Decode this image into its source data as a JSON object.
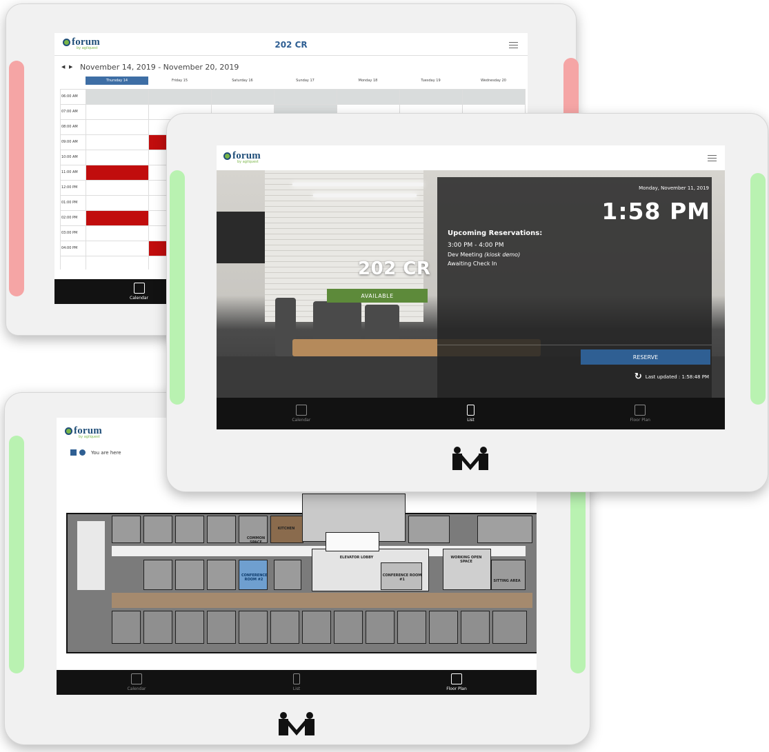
{
  "brand": {
    "logo_word": "forum",
    "logo_sub": "by agilquest",
    "device_logo": "M-icon"
  },
  "colors": {
    "led_red": "#f5a5a5",
    "led_green": "#b9f2b1",
    "available_green": "#5d8a3a",
    "reserve_blue": "#2f5f93",
    "event_red": "#c10d0d",
    "today_blue": "#3e6ea5"
  },
  "calendar_panel": {
    "room_title": "202 CR",
    "date_range": "November 14, 2019 - November 20, 2019",
    "days": [
      "Thursday 14",
      "Friday 15",
      "Saturday 16",
      "Sunday 17",
      "Monday 18",
      "Tuesday 19",
      "Wednesday 20"
    ],
    "times": [
      "06:00 AM",
      "07:00 AM",
      "08:00 AM",
      "09:00 AM",
      "10:00 AM",
      "11:00 AM",
      "12:00 PM",
      "01:00 PM",
      "02:00 PM",
      "03:00 PM",
      "04:00 PM"
    ],
    "nav": [
      {
        "label": "Calendar",
        "icon": "calendar-icon"
      }
    ]
  },
  "room_panel": {
    "room_name": "202 CR",
    "status_button": "AVAILABLE",
    "date": "Monday, November 11, 2019",
    "time": "1:58 PM",
    "upcoming_heading": "Upcoming Reservations:",
    "reservation_time": "3:00 PM - 4:00 PM",
    "reservation_title": "Dev Meeting",
    "reservation_note": "(kiosk demo)",
    "reservation_status": "Awaiting Check In",
    "reserve_button": "RESERVE",
    "last_updated": "Last updated : 1:58:48 PM",
    "nav": [
      {
        "label": "Calendar",
        "icon": "calendar-icon"
      },
      {
        "label": "List",
        "icon": "tablet-icon"
      },
      {
        "label": "Floor Plan",
        "icon": "floor-plan-icon"
      }
    ]
  },
  "floor_panel": {
    "legend": "You are here",
    "labels": {
      "kitchen": "KITCHEN",
      "common": "COMMON SPACE",
      "conf2": "CONFERENCE ROOM #2",
      "elevator": "ELEVATOR LOBBY",
      "conf1": "CONFERENCE ROOM #1",
      "working": "WORKING OPEN SPACE",
      "sitting": "SITTING AREA"
    },
    "nav": [
      {
        "label": "Calendar",
        "icon": "calendar-icon"
      },
      {
        "label": "List",
        "icon": "tablet-icon"
      },
      {
        "label": "Floor Plan",
        "icon": "floor-plan-icon"
      }
    ]
  }
}
